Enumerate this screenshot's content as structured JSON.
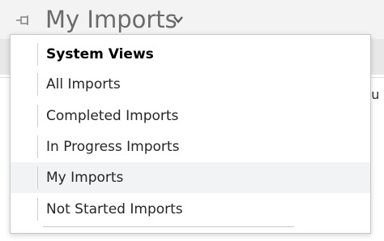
{
  "header": {
    "title": "My Imports",
    "pin_icon": "pin-icon",
    "chevron_icon": "chevron-down-icon"
  },
  "background": {
    "column_peek": "tu"
  },
  "dropdown": {
    "section_heading": "System Views",
    "items": [
      {
        "label": "All Imports"
      },
      {
        "label": "Completed Imports"
      },
      {
        "label": "In Progress Imports"
      },
      {
        "label": "My Imports"
      },
      {
        "label": "Not Started Imports"
      }
    ],
    "selected": "My Imports"
  },
  "colors": {
    "header_bg": "#f3f3f3",
    "title_text": "#6b6b6b",
    "selected_bg": "#f2f3f5"
  }
}
